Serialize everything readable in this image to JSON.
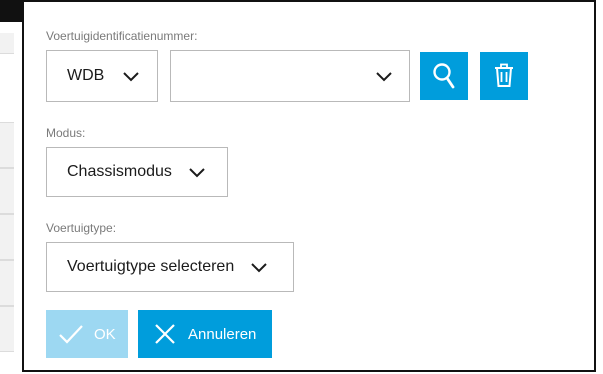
{
  "dialog": {
    "vin": {
      "label": "Voertuigidentificatienummer:",
      "prefix_value": "WDB",
      "number_value": ""
    },
    "mode": {
      "label": "Modus:",
      "value": "Chassismodus"
    },
    "vehicle_type": {
      "label": "Voertuigtype:",
      "value": "Voertuigtype selecteren"
    },
    "buttons": {
      "ok_label": "OK",
      "cancel_label": "Annuleren"
    },
    "icons": {
      "search": "search-icon",
      "delete": "trash-icon",
      "chevron": "chevron-down-icon",
      "check": "check-icon",
      "close": "close-icon"
    }
  },
  "colors": {
    "accent": "#009ddc",
    "disabled": "#9dd8f2",
    "border": "#b9b9b9",
    "label": "#7a7a7a",
    "dialog_border": "#111111"
  }
}
